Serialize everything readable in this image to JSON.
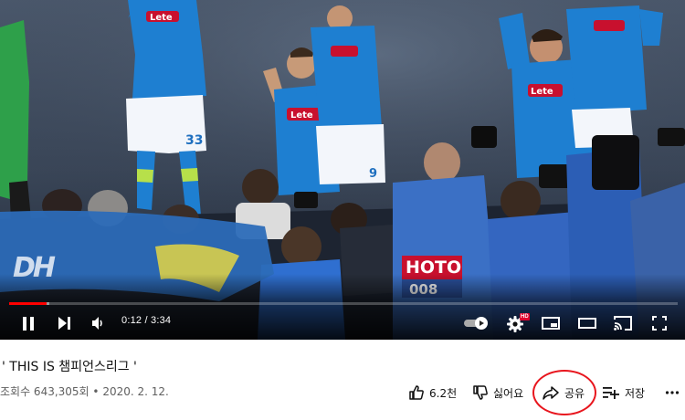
{
  "player": {
    "watermark": "DH",
    "current_time": "0:12",
    "duration": "3:34",
    "time_separator": " / ",
    "progress_fraction": 0.056,
    "buffer_fraction": 0.06,
    "hd_badge": "HD",
    "banner_text": "HOTO",
    "banner_number": "008",
    "accent_color": "#ff0000"
  },
  "video": {
    "title": "' THIS IS 챔피언스리그 '",
    "views": "조회수 643,305회",
    "meta_separator": " • ",
    "date": "2020. 2. 12."
  },
  "actions": {
    "like_count": "6.2천",
    "dislike_label": "싫어요",
    "share_label": "공유",
    "save_label": "저장"
  }
}
